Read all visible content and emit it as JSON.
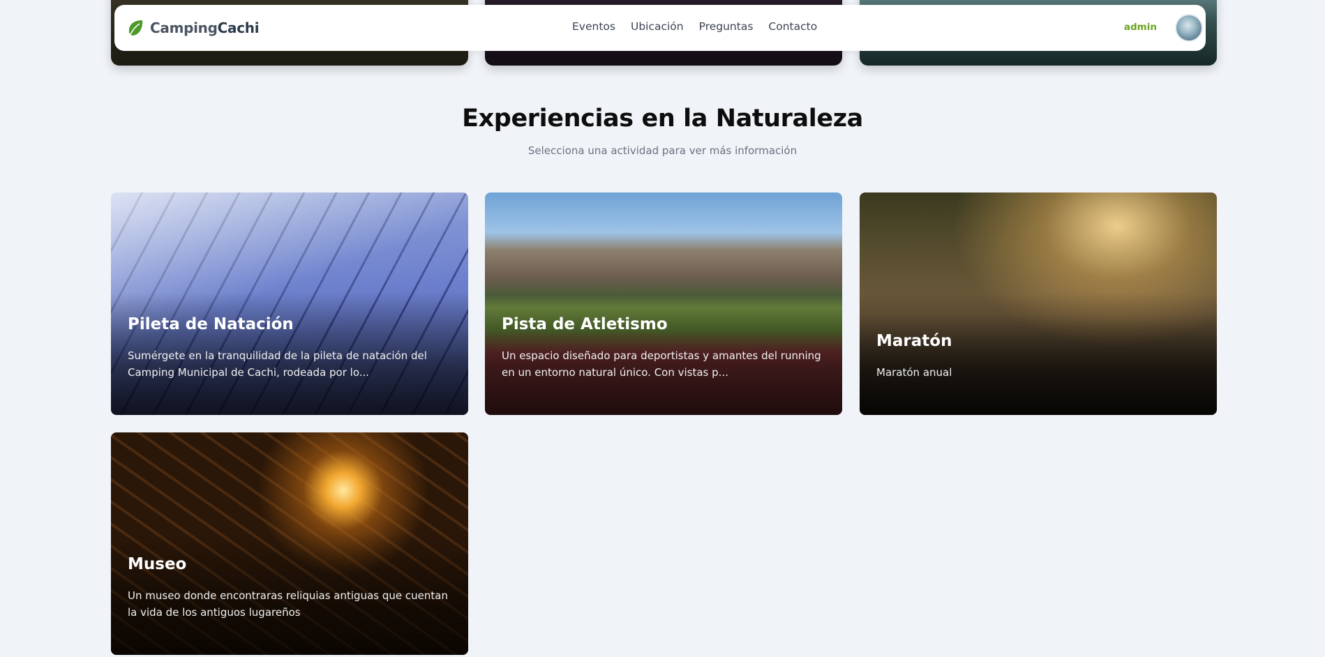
{
  "navbar": {
    "brand_part1": "Camping",
    "brand_part2": "Cachi",
    "links": [
      "Eventos",
      "Ubicación",
      "Preguntas",
      "Contacto"
    ],
    "user": "admin"
  },
  "section": {
    "title": "Experiencias en la Naturaleza",
    "subtitle": "Selecciona una actividad para ver más información"
  },
  "activities": [
    {
      "title": "Pileta de Natación",
      "description": "Sumérgete en la tranquilidad de la pileta de natación del Camping Municipal de Cachi, rodeada por lo..."
    },
    {
      "title": "Pista de Atletismo",
      "description": "Un espacio diseñado para deportistas y amantes del running en un entorno natural único. Con vistas p..."
    },
    {
      "title": "Maratón",
      "description": "Maratón anual"
    },
    {
      "title": "Museo",
      "description": "Un museo donde encontraras reliquias antiguas que cuentan la vida de los antiguos lugareños"
    }
  ],
  "icons": {
    "brand": "leaf-icon",
    "user": "avatar"
  },
  "colors": {
    "accent": "#6aa320",
    "background": "#f0f3f8"
  }
}
